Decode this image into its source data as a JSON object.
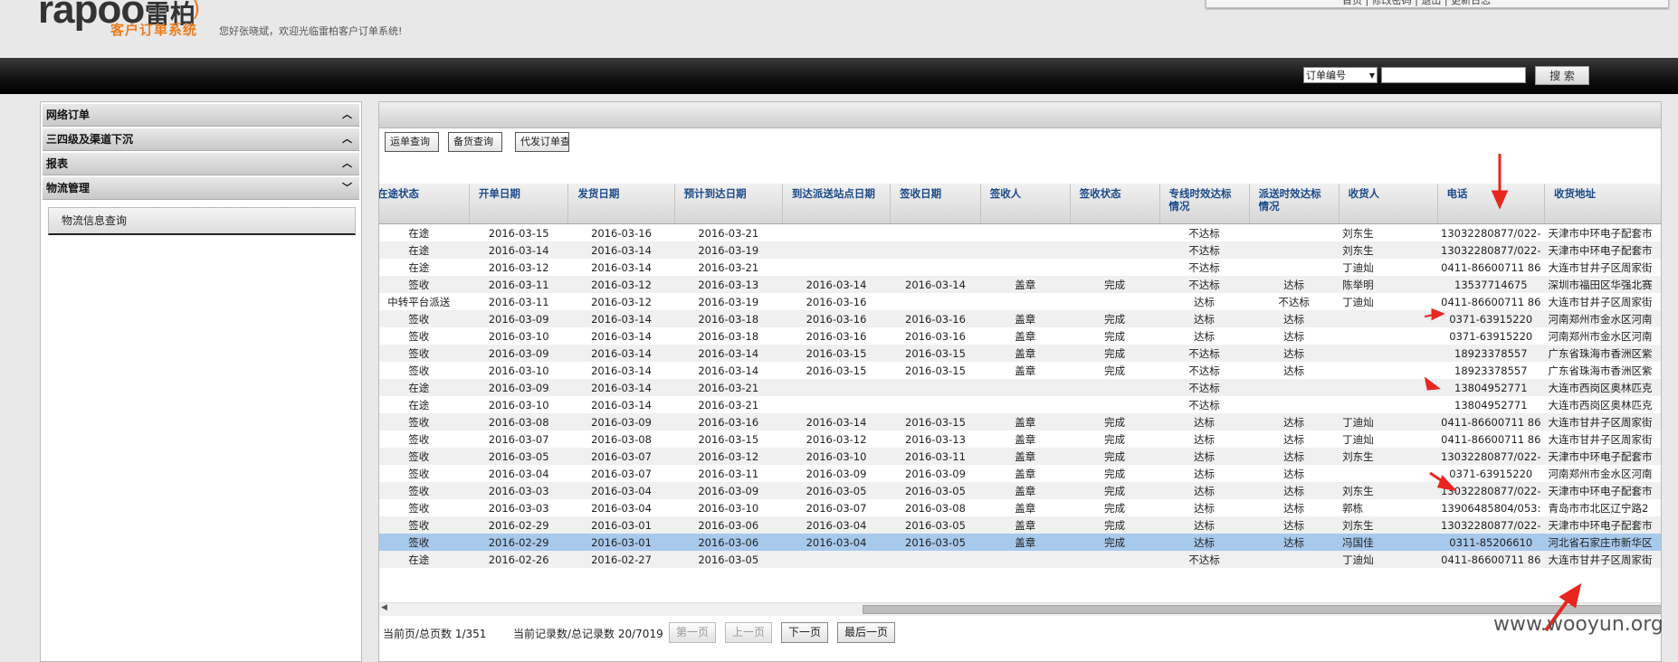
{
  "header": {
    "logo_text": "rapoo",
    "logo_cn": "雷柏",
    "system_name": "客户订单系统",
    "welcome": "您好张晓斌，欢迎光临雷柏客户订单系统!",
    "top_links": "首页 | 修改密码 | 退出 | 更新日志"
  },
  "search": {
    "select_value": "订单编号",
    "input_value": "",
    "button_label": "搜 索"
  },
  "sidebar": {
    "sections": [
      {
        "label": "网络订单",
        "chevron": "up"
      },
      {
        "label": "三四级及渠道下沉",
        "chevron": "up"
      },
      {
        "label": "报表",
        "chevron": "up"
      },
      {
        "label": "物流管理",
        "chevron": "down"
      }
    ],
    "sub_item": "物流信息查询"
  },
  "tabs": [
    "运单查询",
    "备货查询",
    "代发订单查"
  ],
  "table": {
    "columns": [
      "在途状态",
      "开单日期",
      "发货日期",
      "预计到达日期",
      "到达派送站点日期",
      "签收日期",
      "签收人",
      "签收状态",
      "专线时效达标情况",
      "派送时效达标情况",
      "收货人",
      "电话",
      "收货地址"
    ],
    "rows": [
      [
        "在途",
        "2016-03-15",
        "2016-03-16",
        "2016-03-21",
        "",
        "",
        "",
        "",
        "不达标",
        "",
        "刘东生",
        "13032280877/022-",
        "天津市中环电子配套市"
      ],
      [
        "在途",
        "2016-03-14",
        "2016-03-14",
        "2016-03-19",
        "",
        "",
        "",
        "",
        "不达标",
        "",
        "刘东生",
        "13032280877/022-",
        "天津市中环电子配套市"
      ],
      [
        "在途",
        "2016-03-12",
        "2016-03-14",
        "2016-03-21",
        "",
        "",
        "",
        "",
        "不达标",
        "",
        "丁迪灿",
        "0411-86600711 86",
        "大连市甘井子区周家街"
      ],
      [
        "签收",
        "2016-03-11",
        "2016-03-12",
        "2016-03-13",
        "2016-03-14",
        "2016-03-14",
        "盖章",
        "完成",
        "不达标",
        "达标",
        "陈举明",
        "13537714675",
        "深圳市福田区华强北赛"
      ],
      [
        "中转平台派送",
        "2016-03-11",
        "2016-03-12",
        "2016-03-19",
        "2016-03-16",
        "",
        "",
        "",
        "达标",
        "不达标",
        "丁迪灿",
        "0411-86600711 86",
        "大连市甘井子区周家街"
      ],
      [
        "签收",
        "2016-03-09",
        "2016-03-14",
        "2016-03-18",
        "2016-03-16",
        "2016-03-16",
        "盖章",
        "完成",
        "达标",
        "达标",
        "",
        "0371-63915220",
        "河南郑州市金水区河南"
      ],
      [
        "签收",
        "2016-03-10",
        "2016-03-14",
        "2016-03-18",
        "2016-03-16",
        "2016-03-16",
        "盖章",
        "完成",
        "达标",
        "达标",
        "",
        "0371-63915220",
        "河南郑州市金水区河南"
      ],
      [
        "签收",
        "2016-03-09",
        "2016-03-14",
        "2016-03-14",
        "2016-03-15",
        "2016-03-15",
        "盖章",
        "完成",
        "不达标",
        "达标",
        "",
        "18923378557",
        "广东省珠海市香洲区紫"
      ],
      [
        "签收",
        "2016-03-10",
        "2016-03-14",
        "2016-03-14",
        "2016-03-15",
        "2016-03-15",
        "盖章",
        "完成",
        "不达标",
        "达标",
        "",
        "18923378557",
        "广东省珠海市香洲区紫"
      ],
      [
        "在途",
        "2016-03-09",
        "2016-03-14",
        "2016-03-21",
        "",
        "",
        "",
        "",
        "不达标",
        "",
        "",
        "13804952771",
        "大连市西岗区奥林匹克"
      ],
      [
        "在途",
        "2016-03-10",
        "2016-03-14",
        "2016-03-21",
        "",
        "",
        "",
        "",
        "不达标",
        "",
        "",
        "13804952771",
        "大连市西岗区奥林匹克"
      ],
      [
        "签收",
        "2016-03-08",
        "2016-03-09",
        "2016-03-16",
        "2016-03-14",
        "2016-03-15",
        "盖章",
        "完成",
        "达标",
        "达标",
        "丁迪灿",
        "0411-86600711 86",
        "大连市甘井子区周家街"
      ],
      [
        "签收",
        "2016-03-07",
        "2016-03-08",
        "2016-03-15",
        "2016-03-12",
        "2016-03-13",
        "盖章",
        "完成",
        "达标",
        "达标",
        "丁迪灿",
        "0411-86600711 86",
        "大连市甘井子区周家街"
      ],
      [
        "签收",
        "2016-03-05",
        "2016-03-07",
        "2016-03-12",
        "2016-03-10",
        "2016-03-11",
        "盖章",
        "完成",
        "达标",
        "达标",
        "刘东生",
        "13032280877/022-",
        "天津市中环电子配套市"
      ],
      [
        "签收",
        "2016-03-04",
        "2016-03-07",
        "2016-03-11",
        "2016-03-09",
        "2016-03-09",
        "盖章",
        "完成",
        "达标",
        "达标",
        "",
        "0371-63915220",
        "河南郑州市金水区河南"
      ],
      [
        "签收",
        "2016-03-03",
        "2016-03-04",
        "2016-03-09",
        "2016-03-05",
        "2016-03-05",
        "盖章",
        "完成",
        "达标",
        "达标",
        "刘东生",
        "13032280877/022-",
        "天津市中环电子配套市"
      ],
      [
        "签收",
        "2016-03-03",
        "2016-03-04",
        "2016-03-10",
        "2016-03-07",
        "2016-03-08",
        "盖章",
        "完成",
        "达标",
        "达标",
        "郭栋",
        "13906485804/053:",
        "青岛市市北区辽宁路2"
      ],
      [
        "签收",
        "2016-02-29",
        "2016-03-01",
        "2016-03-06",
        "2016-03-04",
        "2016-03-05",
        "盖章",
        "完成",
        "达标",
        "达标",
        "刘东生",
        "13032280877/022-",
        "天津市中环电子配套市"
      ],
      [
        "签收",
        "2016-02-29",
        "2016-03-01",
        "2016-03-06",
        "2016-03-04",
        "2016-03-05",
        "盖章",
        "完成",
        "达标",
        "达标",
        "冯国佳",
        "0311-85206610",
        "河北省石家庄市新华区"
      ],
      [
        "在途",
        "2016-02-26",
        "2016-02-27",
        "2016-03-05",
        "",
        "",
        "",
        "",
        "不达标",
        "",
        "丁迪灿",
        "0411-86600711 86",
        "大连市甘井子区周家街"
      ]
    ],
    "selected_row": 18
  },
  "pager": {
    "page_info": "当前页/总页数 1/351",
    "record_info": "当前记录数/总记录数 20/7019",
    "first": "第一页",
    "prev": "上一页",
    "next": "下一页",
    "last": "最后一页"
  },
  "watermark": "www.wooyun.org",
  "colors": {
    "accent_orange": "#ec7d1f",
    "header_text_blue": "#1a4a8a",
    "selected_row": "#a7c9ec",
    "annotation_red": "#e8261f"
  }
}
